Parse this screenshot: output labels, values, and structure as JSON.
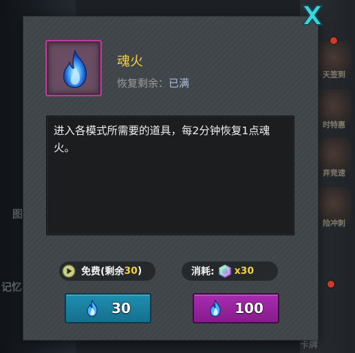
{
  "background": {
    "side_labels": [
      "天签到",
      "时特惠",
      "弃竞速",
      "险冲刺"
    ],
    "left_texts": [
      "记忆",
      "图"
    ],
    "bottom_text": "卡牌"
  },
  "modal": {
    "close_icon": "close-icon",
    "item": {
      "icon": "blue-flame-icon",
      "name": "魂火",
      "restore_label": "恢复剩余：",
      "restore_value": "已满"
    },
    "description": "进入各模式所需要的道具，每2分钟恢复1点魂火。",
    "free_pill": {
      "icon": "play-icon",
      "label_prefix": "免费(剩余",
      "count": "30",
      "label_suffix": ")"
    },
    "cost_pill": {
      "label": "消耗:",
      "icon": "gem-icon",
      "amount": "x30"
    },
    "buttons": [
      {
        "icon": "blue-flame-icon",
        "value": "30"
      },
      {
        "icon": "blue-flame-icon",
        "value": "100"
      }
    ]
  },
  "colors": {
    "accent_yellow": "#f0d044",
    "blue_button": "#1f8fb1",
    "purple_button": "#a82bb0",
    "item_border": "#c2399f"
  }
}
